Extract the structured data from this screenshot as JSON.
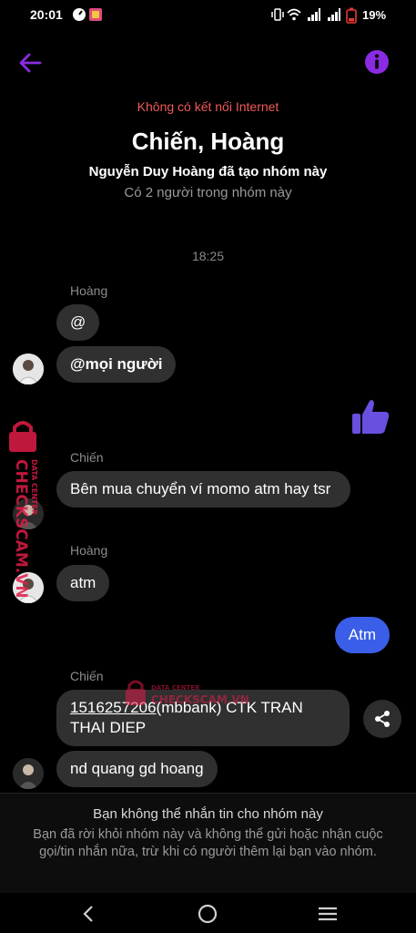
{
  "status_bar": {
    "time": "20:01",
    "battery": "19%"
  },
  "header": {
    "no_internet": "Không có kết nối Internet",
    "group_name": "Chiến, Hoàng",
    "created_by": "Nguyễn Duy Hoàng đã tạo nhóm này",
    "member_count": "Có 2 người trong nhóm này",
    "accent_color": "#8a2be2"
  },
  "conversation": {
    "timestamp": "18:25",
    "messages": [
      {
        "sender": "Hoàng",
        "bubbles": [
          "@",
          "@mọi người"
        ]
      },
      {
        "outgoing_reaction": "thumbs-up"
      },
      {
        "sender": "Chiến",
        "bubbles": [
          "Bên mua chuyển ví momo atm hay tsr"
        ]
      },
      {
        "sender": "Hoàng",
        "bubbles": [
          "atm"
        ]
      },
      {
        "outgoing": "Atm"
      },
      {
        "sender": "Chiến",
        "account_number": "1516257206",
        "bubble_rest": "(mbbank) CTK TRAN THAI DIEP",
        "bubble2": "nd quang gd hoang"
      }
    ]
  },
  "watermark": {
    "brand": "CHECKSCAM.VN",
    "tagline": "DATA CENTER"
  },
  "footer": {
    "title": "Bạn không thể nhắn tin cho nhóm này",
    "text": "Bạn đã rời khỏi nhóm này và không thể gửi hoặc nhận cuộc gọi/tin nhắn nữa, trừ khi có người thêm lại bạn vào nhóm."
  },
  "colors": {
    "outgoing_bubble": "#3b5ee8",
    "incoming_bubble": "#303030",
    "thumb": "#6b4fe0",
    "warning": "#f05a5a"
  }
}
